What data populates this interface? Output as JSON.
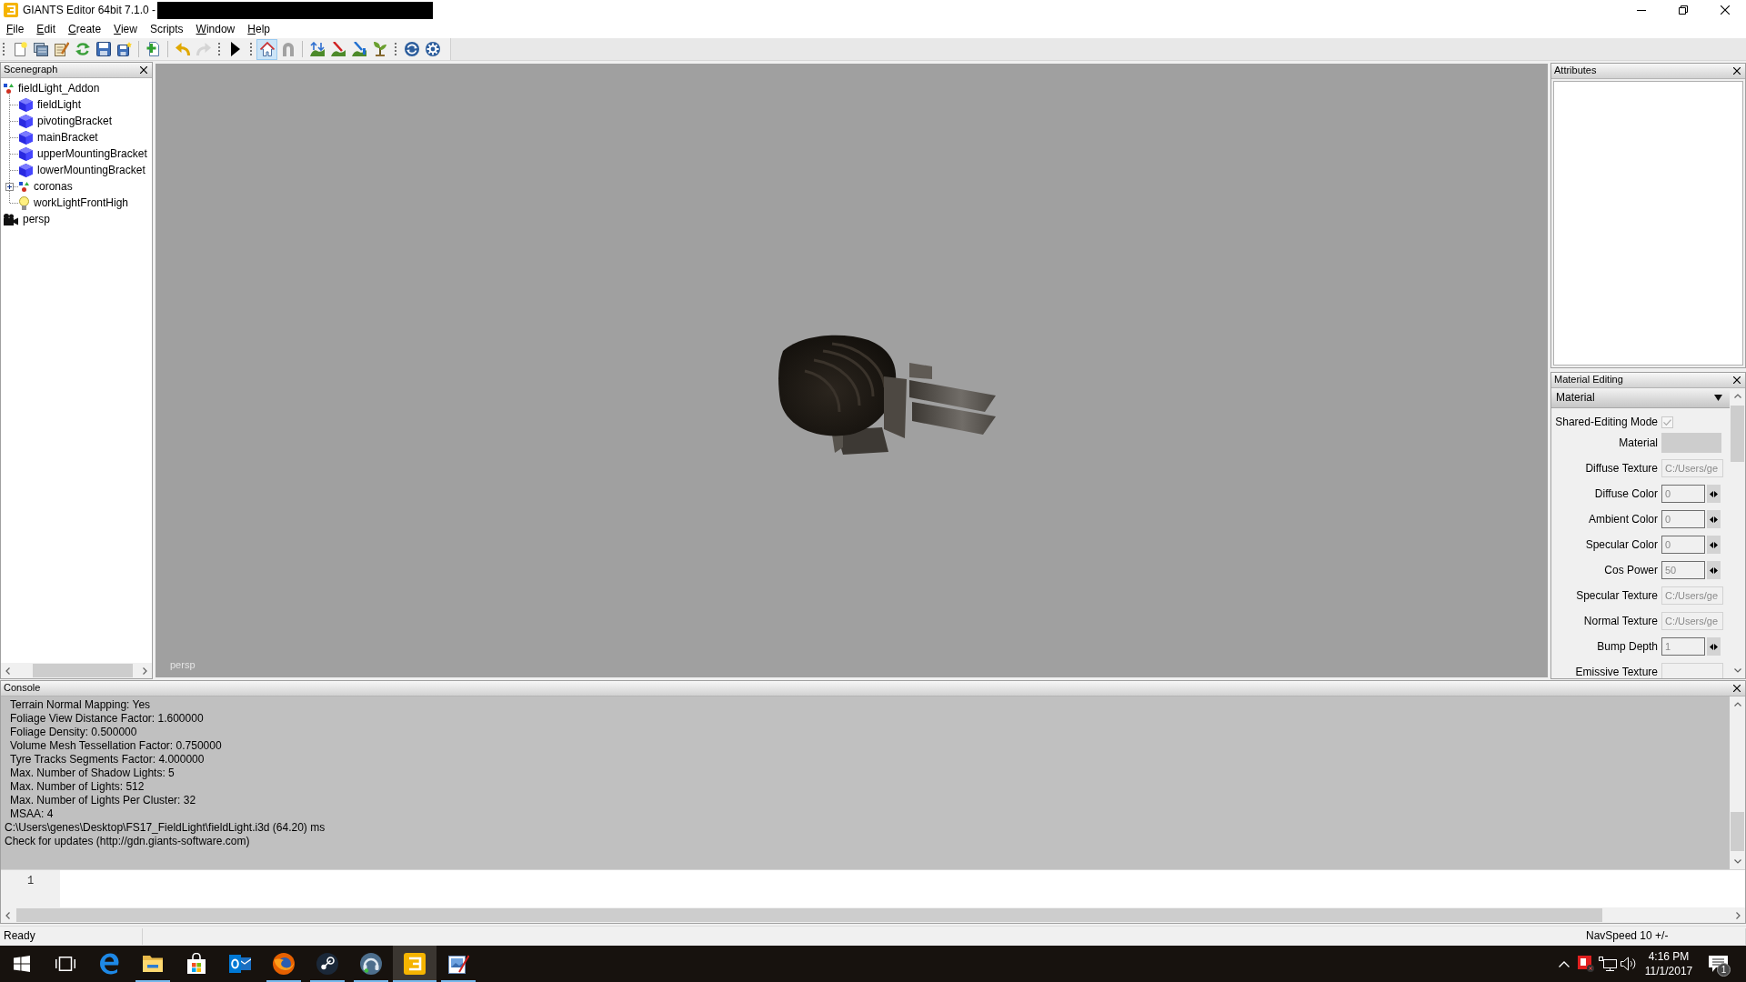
{
  "window": {
    "title": "GIANTS Editor 64bit 7.1.0 -"
  },
  "menu": [
    {
      "label": "File",
      "shortcut_underlined": true
    },
    {
      "label": "Edit",
      "shortcut_underlined": true
    },
    {
      "label": "Create",
      "shortcut_underlined": true
    },
    {
      "label": "View",
      "shortcut_underlined": true
    },
    {
      "label": "Scripts",
      "shortcut_underlined": false
    },
    {
      "label": "Window",
      "shortcut_underlined": true
    },
    {
      "label": "Help",
      "shortcut_underlined": true
    }
  ],
  "toolbar": [
    {
      "grip": true,
      "buttons": [
        {
          "pressed": false,
          "disabled": false
        },
        {
          "pressed": false,
          "disabled": false
        },
        {
          "pressed": false,
          "disabled": false
        },
        {
          "pressed": false,
          "disabled": false
        },
        {
          "pressed": false,
          "disabled": false
        },
        {
          "pressed": false,
          "disabled": false
        }
      ]
    },
    {
      "grip": false,
      "buttons": [
        {
          "pressed": false,
          "disabled": false
        }
      ]
    },
    {
      "grip": false,
      "buttons": [
        {
          "pressed": false,
          "disabled": false
        },
        {
          "pressed": false,
          "disabled": true
        }
      ]
    },
    {
      "grip": true,
      "buttons": [
        {
          "pressed": false,
          "disabled": false
        }
      ]
    },
    {
      "grip": true,
      "buttons": [
        {
          "pressed": true,
          "disabled": false
        },
        {
          "pressed": false,
          "disabled": true
        }
      ]
    },
    {
      "grip": false,
      "buttons": [
        {
          "pressed": false,
          "disabled": false
        },
        {
          "pressed": false,
          "disabled": false
        },
        {
          "pressed": false,
          "disabled": false
        },
        {
          "pressed": false,
          "disabled": false
        }
      ]
    },
    {
      "grip": true,
      "buttons": [
        {
          "pressed": false,
          "disabled": false
        },
        {
          "pressed": false,
          "disabled": false
        }
      ]
    }
  ],
  "scenegraph": {
    "title": "Scenegraph",
    "tree": [
      {
        "label": "fieldLight_Addon",
        "kind": "transform",
        "children": [
          {
            "label": "fieldLight",
            "kind": "shape"
          },
          {
            "label": "pivotingBracket",
            "kind": "shape"
          },
          {
            "label": "mainBracket",
            "kind": "shape"
          },
          {
            "label": "upperMountingBracket",
            "kind": "shape"
          },
          {
            "label": "lowerMountingBracket",
            "kind": "shape"
          },
          {
            "label": "coronas",
            "kind": "transform",
            "expanded": false
          },
          {
            "label": "workLightFrontHigh",
            "kind": "light"
          }
        ]
      },
      {
        "label": "persp",
        "kind": "camera"
      }
    ]
  },
  "viewport": {
    "camera_label": "persp"
  },
  "attributes": {
    "title": "Attributes"
  },
  "material_editing": {
    "title": "Material Editing",
    "section": "Material",
    "fields": [
      {
        "label": "Shared-Editing Mode",
        "kind": "checkbox",
        "checked": true,
        "disabled": true
      },
      {
        "label": "Material",
        "kind": "swatch",
        "disabled": true
      },
      {
        "label": "Diffuse Texture",
        "kind": "path",
        "value": "C:/Users/ge",
        "disabled": true
      },
      {
        "label": "Diffuse Color",
        "kind": "number",
        "value": "0",
        "disabled": false
      },
      {
        "label": "Ambient Color",
        "kind": "number",
        "value": "0",
        "disabled": false
      },
      {
        "label": "Specular Color",
        "kind": "number",
        "value": "0",
        "disabled": false
      },
      {
        "label": "Cos Power",
        "kind": "number",
        "value": "50",
        "disabled": false
      },
      {
        "label": "Specular Texture",
        "kind": "path",
        "value": "C:/Users/ge",
        "disabled": true
      },
      {
        "label": "Normal Texture",
        "kind": "path",
        "value": "C:/Users/ge",
        "disabled": true
      },
      {
        "label": "Bump Depth",
        "kind": "number",
        "value": "1",
        "disabled": false
      },
      {
        "label": "Emissive Texture",
        "kind": "path",
        "disabled": true
      }
    ]
  },
  "console": {
    "title": "Console",
    "lines": [
      {
        "kind": "detail",
        "text": "Terrain Normal Mapping: Yes"
      },
      {
        "kind": "detail",
        "text": "Foliage View Distance Factor: 1.600000"
      },
      {
        "kind": "detail",
        "text": "Foliage Density: 0.500000"
      },
      {
        "kind": "detail",
        "text": "Volume Mesh Tessellation Factor: 0.750000"
      },
      {
        "kind": "detail",
        "text": "Tyre Tracks Segments Factor: 4.000000"
      },
      {
        "kind": "detail",
        "text": "Max. Number of Shadow Lights: 5"
      },
      {
        "kind": "detail",
        "text": "Max. Number of Lights: 512"
      },
      {
        "kind": "detail",
        "text": "Max. Number of Lights Per Cluster: 32"
      },
      {
        "kind": "detail",
        "text": "MSAA: 4"
      },
      {
        "kind": "message",
        "text": "C:\\Users\\genes\\Desktop\\FS17_FieldLight\\fieldLight.i3d (64.20) ms"
      },
      {
        "kind": "message",
        "text": "Check for updates (http://gdn.giants-software.com)"
      }
    ],
    "input_line_numbers": [
      "1"
    ]
  },
  "status_bar": {
    "message": "Ready",
    "nav_speed": "NavSpeed 10 +/-"
  },
  "taskbar": {
    "apps": [
      {
        "running": false,
        "selected": false
      },
      {
        "running": true,
        "selected": false
      },
      {
        "running": false,
        "selected": false
      },
      {
        "running": false,
        "selected": false
      },
      {
        "running": true,
        "selected": false
      },
      {
        "running": true,
        "selected": false
      },
      {
        "running": true,
        "selected": false
      },
      {
        "running": true,
        "selected": true
      },
      {
        "running": true,
        "selected": false
      }
    ],
    "clock": {
      "time": "4:16 PM",
      "date": "11/1/2017"
    },
    "notification_count": "1"
  }
}
